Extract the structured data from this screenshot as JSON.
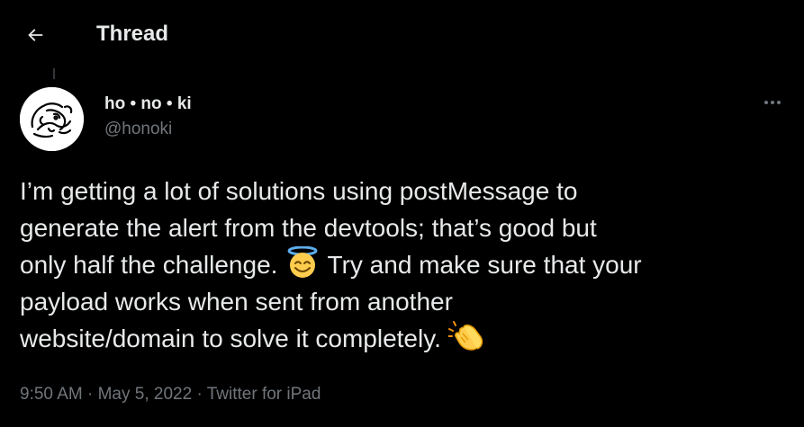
{
  "header": {
    "back_icon": "arrow-left-icon",
    "title": "Thread"
  },
  "tweet": {
    "author": {
      "display_name": "ho • no • ki",
      "handle": "@honoki",
      "avatar_icon": "lion-sketch-avatar"
    },
    "more_icon": "more-horizontal-icon",
    "text_lines": [
      "I’m getting a lot of solutions using postMessage to",
      "generate the alert from the devtools; that’s good but",
      "only half the challenge.",
      "Try and make sure that your",
      "payload works when sent from another",
      "website/domain to solve it completely."
    ],
    "emojis": [
      "smiling-face-with-halo-emoji",
      "clapping-hands-emoji"
    ],
    "time": "9:50 AM",
    "separator": "·",
    "date": "May 5, 2022",
    "source": "Twitter for iPad"
  },
  "colors": {
    "background": "#000000",
    "text_primary": "#e7e9ea",
    "text_secondary": "#71767b"
  }
}
